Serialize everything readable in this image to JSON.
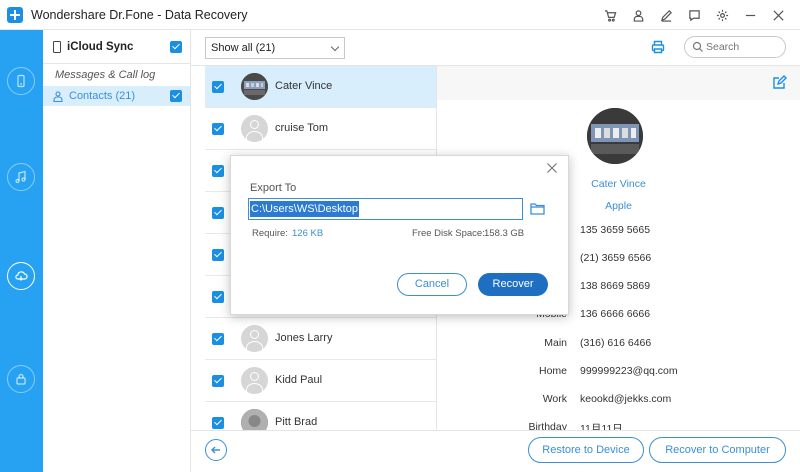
{
  "app": {
    "title": "Wondershare Dr.Fone - Data Recovery"
  },
  "titlebar_icons": [
    "cart-icon",
    "user-icon",
    "pen-icon",
    "feedback-icon",
    "gear-icon",
    "minimize-icon",
    "close-icon"
  ],
  "nav": [
    "phone-recover-icon",
    "music-icon",
    "icloud-icon",
    "lock-icon"
  ],
  "source": {
    "title": "iCloud Sync",
    "category": "Messages & Call log",
    "item": "Contacts (21)"
  },
  "toolbar": {
    "filter": "Show all (21)",
    "search_placeholder": "Search"
  },
  "contacts": [
    {
      "name": "Cater Vince"
    },
    {
      "name": "cruise Tom"
    },
    {
      "name": ""
    },
    {
      "name": ""
    },
    {
      "name": ""
    },
    {
      "name": ""
    },
    {
      "name": "Jones Larry"
    },
    {
      "name": "Kidd Paul"
    },
    {
      "name": "Pitt Brad"
    }
  ],
  "detail": {
    "name": "Cater Vince",
    "company": "Apple",
    "fields": [
      {
        "label": "",
        "value": "135 3659 5665"
      },
      {
        "label": "",
        "value": "(21) 3659 6566"
      },
      {
        "label": "",
        "value": "138 8669 5869"
      },
      {
        "label": "Mobile",
        "value": "136 6666 6666"
      },
      {
        "label": "Main",
        "value": "(316) 616 6466"
      },
      {
        "label": "Home",
        "value": "999999223@qq.com"
      },
      {
        "label": "Work",
        "value": "keookd@jekks.com"
      },
      {
        "label": "Birthday",
        "value": "11月11日"
      }
    ]
  },
  "dialog": {
    "title": "Export To",
    "path": "C:\\Users\\WS\\Desktop",
    "require_label": "Require:",
    "require_value": "126 KB",
    "free_label": "Free Disk Space:",
    "free_value": "158.3 GB",
    "cancel": "Cancel",
    "recover": "Recover"
  },
  "bottom": {
    "restore_device": "Restore to Device",
    "recover_computer": "Recover to Computer"
  },
  "colors": {
    "accent": "#27a2f3",
    "link": "#3a8fd6",
    "primary_button": "#1e6fc1",
    "selection": "#d9eefc"
  }
}
